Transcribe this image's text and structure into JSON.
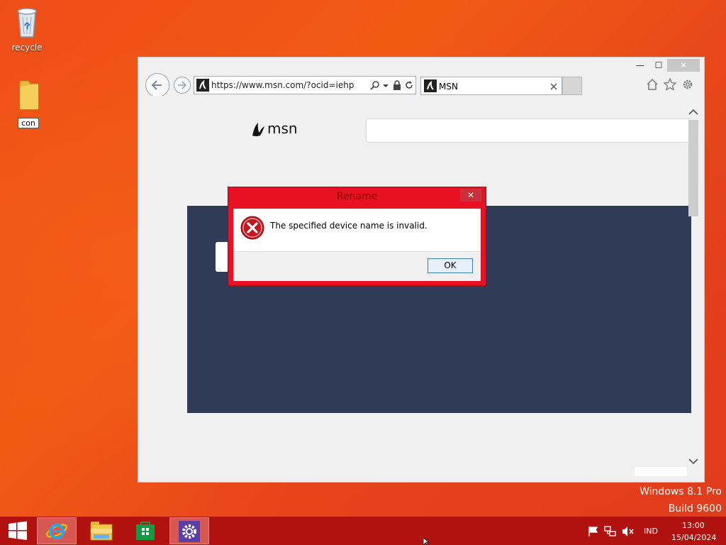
{
  "desktop": {
    "icons": [
      {
        "label": "recycle"
      },
      {
        "label": "con"
      }
    ]
  },
  "browser": {
    "url": "https://www.msn.com/?ocid=iehp",
    "tab_title": "MSN",
    "page": {
      "brand": "msn"
    },
    "window_controls": {
      "minimize": "—",
      "maximize": "☐",
      "close": "✕"
    }
  },
  "dialog": {
    "title": "Rename",
    "message": "The specified device name is invalid.",
    "ok_label": "OK",
    "close_glyph": "✕"
  },
  "watermark": {
    "line1": "Windows 8.1 Pro",
    "line2": "Build 9600"
  },
  "tray": {
    "language": "IND",
    "time": "13:00",
    "date": "15/04/2024"
  },
  "colors": {
    "accent_taskbar": "#b1120f",
    "dialog_frame": "#e81123",
    "panel": "#2f3b57"
  }
}
